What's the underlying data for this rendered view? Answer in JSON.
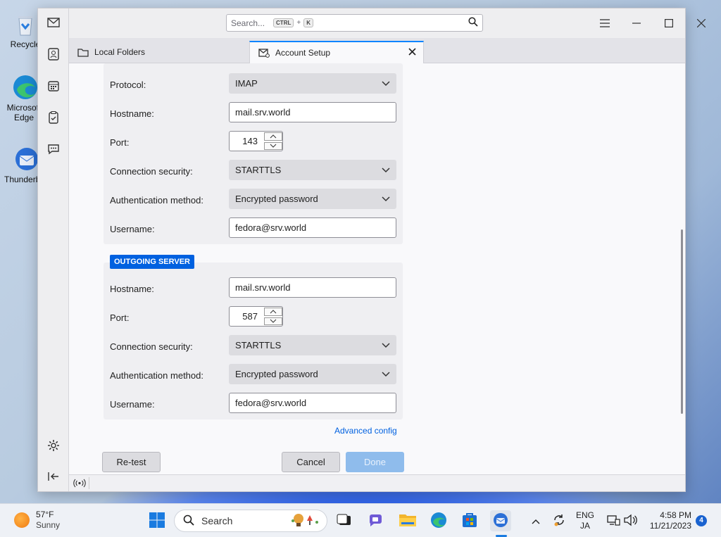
{
  "desktop": {
    "icons": [
      {
        "label": "Recycle"
      },
      {
        "label": "Microsoft Edge"
      },
      {
        "label": "Thunderbird"
      }
    ]
  },
  "window": {
    "search": {
      "placeholder": "Search...",
      "key_ctrl": "CTRL",
      "plus": "+",
      "key_k": "K"
    },
    "tabs": [
      {
        "label": "Local Folders",
        "icon": "folder-icon"
      },
      {
        "label": "Account Setup",
        "icon": "account-setup-icon",
        "active": true
      }
    ],
    "incoming": {
      "protocol_label": "Protocol:",
      "protocol_value": "IMAP",
      "hostname_label": "Hostname:",
      "hostname_value": "mail.srv.world",
      "port_label": "Port:",
      "port_value": "143",
      "security_label": "Connection security:",
      "security_value": "STARTTLS",
      "auth_label": "Authentication method:",
      "auth_value": "Encrypted password",
      "username_label": "Username:",
      "username_value": "fedora@srv.world"
    },
    "outgoing": {
      "badge": "OUTGOING SERVER",
      "hostname_label": "Hostname:",
      "hostname_value": "mail.srv.world",
      "port_label": "Port:",
      "port_value": "587",
      "security_label": "Connection security:",
      "security_value": "STARTTLS",
      "auth_label": "Authentication method:",
      "auth_value": "Encrypted password",
      "username_label": "Username:",
      "username_value": "fedora@srv.world"
    },
    "advanced_link": "Advanced config",
    "buttons": {
      "retest": "Re-test",
      "cancel": "Cancel",
      "done": "Done"
    }
  },
  "taskbar": {
    "weather": {
      "temp": "57°F",
      "condition": "Sunny"
    },
    "search_label": "Search",
    "lang_top": "ENG",
    "lang_bottom": "JA",
    "time": "4:58 PM",
    "date": "11/21/2023",
    "notification_count": "4"
  },
  "colors": {
    "accent": "#0061e0",
    "done_disabled": "#8fbcec"
  }
}
